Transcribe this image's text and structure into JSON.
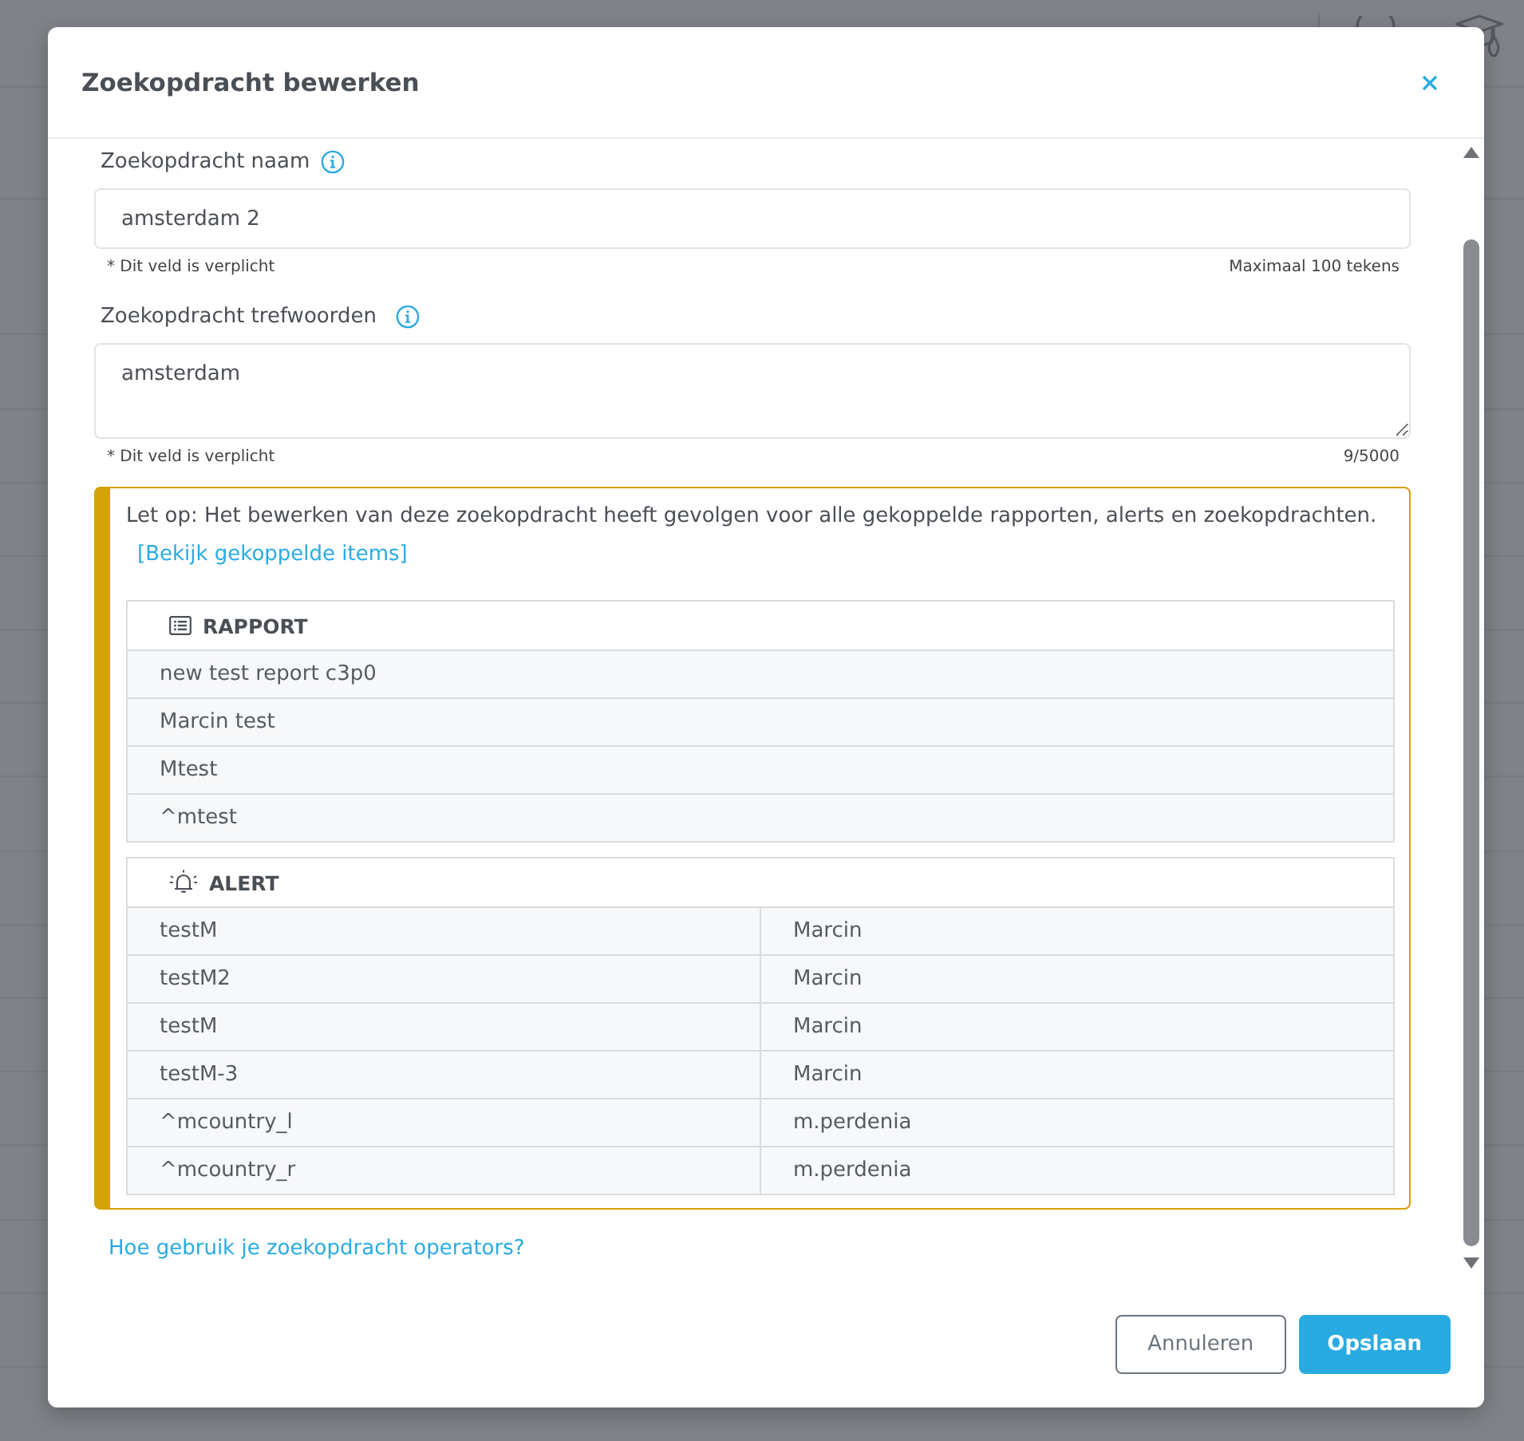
{
  "dialog": {
    "title": "Zoekopdracht bewerken"
  },
  "fields": [
    {
      "kind": "input",
      "label": "Zoekopdracht naam",
      "value": "amsterdam 2",
      "note": "* Dit veld is verplicht",
      "counter": "Maximaal 100 tekens"
    },
    {
      "kind": "textarea",
      "label": "Zoekopdracht trefwoorden",
      "value": "amsterdam",
      "note": "* Dit veld is verplicht",
      "counter": "9/5000"
    }
  ],
  "warning": {
    "text": "Let op: Het bewerken van deze zoekopdracht heeft gevolgen voor alle gekoppelde rapporten, alerts en zoekopdrachten.",
    "link": "[Bekijk gekoppelde items]",
    "tables": [
      {
        "kind": "report",
        "title": "RAPPORT",
        "rows": [
          [
            "new test report c3p0"
          ],
          [
            "Marcin test"
          ],
          [
            "Mtest"
          ],
          [
            "^mtest"
          ]
        ]
      },
      {
        "kind": "alert",
        "title": "ALERT",
        "rows": [
          [
            "testM",
            "Marcin"
          ],
          [
            "testM2",
            "Marcin"
          ],
          [
            "testM",
            "Marcin"
          ],
          [
            "testM-3",
            "Marcin"
          ],
          [
            "^mcountry_l",
            "m.perdenia"
          ],
          [
            "^mcountry_r",
            "m.perdenia"
          ]
        ]
      }
    ]
  },
  "help_link": "Hoe gebruik je zoekopdracht operators?",
  "buttons": [
    {
      "kind": "secondary",
      "label": "Annuleren"
    },
    {
      "kind": "primary",
      "label": "Opslaan"
    }
  ]
}
